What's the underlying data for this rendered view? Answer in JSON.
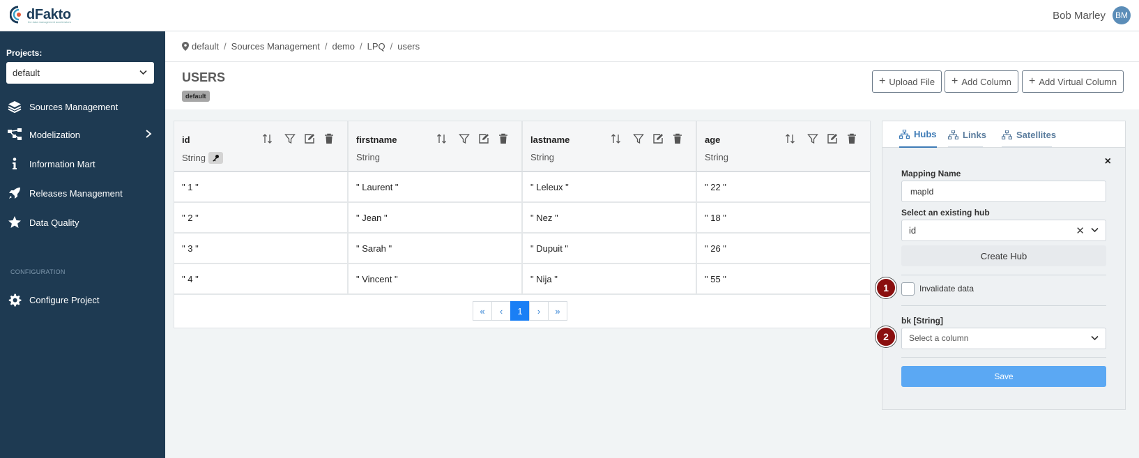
{
  "app": {
    "logo_text": "dFakto",
    "logo_tagline": "the data management accelerators"
  },
  "user": {
    "name": "Bob Marley",
    "initials": "BM"
  },
  "sidebar": {
    "projects_label": "Projects:",
    "project_selected": "default",
    "items": [
      {
        "label": "Sources Management",
        "icon": "layers-icon"
      },
      {
        "label": "Modelization",
        "icon": "diagram-icon"
      },
      {
        "label": "Information Mart",
        "icon": "info-icon"
      },
      {
        "label": "Releases Management",
        "icon": "rocket-icon"
      },
      {
        "label": "Data Quality",
        "icon": "star-icon"
      }
    ],
    "config_label": "CONFIGURATION",
    "config_item": {
      "label": "Configure Project",
      "icon": "gear-icon"
    }
  },
  "breadcrumb": [
    "default",
    "Sources Management",
    "demo",
    "LPQ",
    "users"
  ],
  "header": {
    "title": "USERS",
    "badge": "default",
    "upload_label": "Upload File",
    "add_column_label": "Add Column",
    "add_virtual_column_label": "Add Virtual Column"
  },
  "table": {
    "columns": [
      {
        "name": "id",
        "type": "String",
        "is_key": true
      },
      {
        "name": "firstname",
        "type": "String",
        "is_key": false
      },
      {
        "name": "lastname",
        "type": "String",
        "is_key": false
      },
      {
        "name": "age",
        "type": "String",
        "is_key": false
      }
    ],
    "rows": [
      [
        "\" 1 \"",
        "\" Laurent \"",
        "\" Leleux \"",
        "\" 22 \""
      ],
      [
        "\" 2 \"",
        "\" Jean \"",
        "\" Nez \"",
        "\" 18 \""
      ],
      [
        "\" 3 \"",
        "\" Sarah \"",
        "\" Dupuit \"",
        "\" 26 \""
      ],
      [
        "\" 4 \"",
        "\" Vincent \"",
        "\" Nija \"",
        "\" 55 \""
      ]
    ],
    "pagination": {
      "first": "«",
      "prev": "‹",
      "current": "1",
      "next": "›",
      "last": "»"
    }
  },
  "panel": {
    "tabs": [
      "Hubs",
      "Links",
      "Satellites"
    ],
    "active_tab": "Hubs",
    "close_label": "×",
    "mapping_name_label": "Mapping Name",
    "mapping_name_value": "mapId",
    "hub_label": "Select an existing hub",
    "hub_value": "id",
    "create_hub_label": "Create Hub",
    "invalidate_label": "Invalidate data",
    "invalidate_checked": false,
    "bk_label": "bk [String]",
    "bk_placeholder": "Select a column",
    "save_label": "Save"
  },
  "markers": [
    "1",
    "2"
  ],
  "colors": {
    "sidebar_bg": "#1e3a52",
    "primary": "#1a7ff5",
    "save_bg": "#5ba8f3",
    "marker": "#8a0f0f",
    "tab_active": "#3e7bb6"
  }
}
